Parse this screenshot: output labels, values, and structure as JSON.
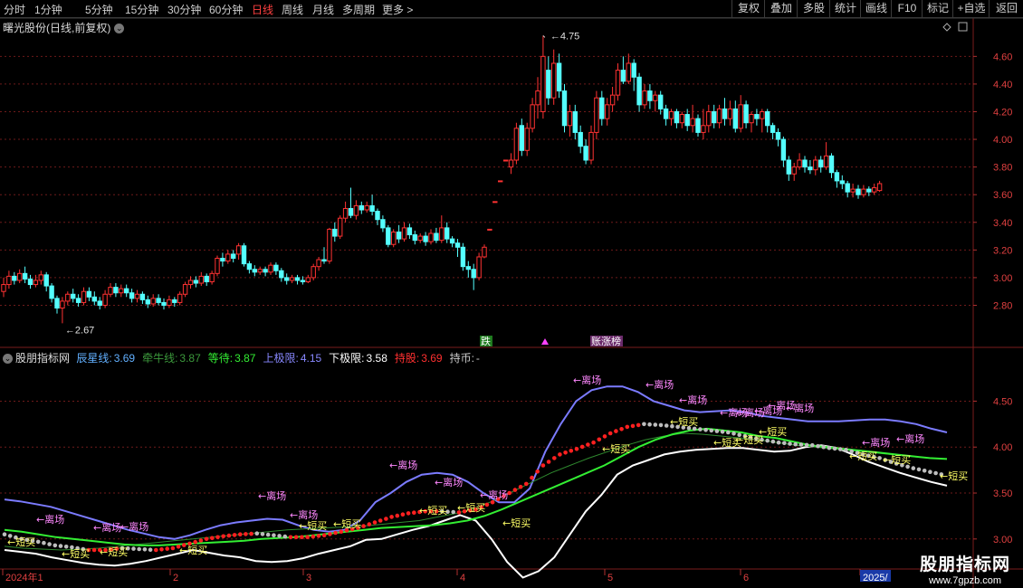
{
  "toolbar": {
    "periods": [
      "分时",
      "1分钟",
      "5分钟",
      "15分钟",
      "30分钟",
      "60分钟",
      "日线",
      "周线",
      "月线",
      "多周期",
      "更多 >"
    ],
    "active_period": "日线",
    "buttons": [
      "复权",
      "叠加",
      "多股",
      "统计",
      "画线",
      "F10",
      "标记",
      "+自选",
      "返回"
    ]
  },
  "main_chart": {
    "title": "曙光股份(日线,前复权)",
    "high_label": "4.75",
    "low_label": "2.67",
    "price_axis": [
      "4.60",
      "4.40",
      "4.20",
      "4.00",
      "3.80",
      "3.60",
      "3.40",
      "3.20",
      "3.00",
      "2.80"
    ],
    "markers": {
      "die": "跌",
      "zhangbang": "账涨榜"
    },
    "colors": {
      "up": "#ff3232",
      "down": "#54ffff",
      "bg": "#000000",
      "grid": "#6e1a1a"
    }
  },
  "indicator": {
    "name": "股朋指标网",
    "items": [
      {
        "label": "辰星线:",
        "value": "3.69",
        "color": "#62b0ff"
      },
      {
        "label": "牵牛线:",
        "value": "3.87",
        "color": "#3c9a3c"
      },
      {
        "label": "等待:",
        "value": "3.87",
        "color": "#33ee33"
      },
      {
        "label": "上极限:",
        "value": "4.15",
        "color": "#8888ff"
      },
      {
        "label": "下极限:",
        "value": "3.58",
        "color": "#ffffff"
      },
      {
        "label": "持股:",
        "value": "3.69",
        "color": "#ff3030"
      },
      {
        "label": "持币:",
        "value": "-",
        "color": "#cccccc"
      }
    ],
    "axis": [
      "4.50",
      "4.00",
      "3.50",
      "3.00"
    ],
    "signal_leave": "←离场",
    "signal_buy": "←短买"
  },
  "time_axis": [
    "2024年1",
    "2",
    "3",
    "4",
    "5",
    "6",
    "2025/"
  ],
  "watermark": {
    "title": "股朋指标网",
    "url": "www.7gpzb.com"
  },
  "chart_data": {
    "type": "candlestick",
    "title": "曙光股份(日线,前复权)",
    "ylim": [
      2.62,
      4.72
    ],
    "ylabels": [
      "4.60",
      "4.40",
      "4.20",
      "4.00",
      "3.80",
      "3.60",
      "3.40",
      "3.20",
      "3.00",
      "2.80"
    ],
    "annotations": {
      "max": 4.75,
      "min": 2.67
    },
    "candles": [
      [
        2.9,
        2.95,
        3.0,
        2.86
      ],
      [
        2.95,
        3.01,
        3.05,
        2.92
      ],
      [
        3.01,
        2.98,
        3.04,
        2.95
      ],
      [
        2.98,
        3.03,
        3.06,
        2.96
      ],
      [
        3.03,
        2.99,
        3.08,
        2.96
      ],
      [
        2.99,
        2.95,
        3.02,
        2.92
      ],
      [
        2.95,
        2.98,
        3.02,
        2.93
      ],
      [
        2.98,
        3.02,
        3.05,
        2.95
      ],
      [
        3.02,
        2.94,
        3.04,
        2.9
      ],
      [
        2.94,
        2.85,
        2.96,
        2.82
      ],
      [
        2.85,
        2.78,
        2.87,
        2.74
      ],
      [
        2.78,
        2.83,
        2.86,
        2.67
      ],
      [
        2.83,
        2.88,
        2.9,
        2.8
      ],
      [
        2.88,
        2.85,
        2.92,
        2.82
      ],
      [
        2.85,
        2.82,
        2.88,
        2.79
      ],
      [
        2.82,
        2.9,
        2.93,
        2.8
      ],
      [
        2.9,
        2.86,
        2.93,
        2.83
      ],
      [
        2.86,
        2.83,
        2.9,
        2.8
      ],
      [
        2.83,
        2.8,
        2.86,
        2.77
      ],
      [
        2.8,
        2.88,
        2.91,
        2.78
      ],
      [
        2.88,
        2.93,
        2.96,
        2.86
      ],
      [
        2.93,
        2.89,
        2.96,
        2.86
      ],
      [
        2.89,
        2.92,
        2.95,
        2.86
      ],
      [
        2.92,
        2.89,
        2.95,
        2.86
      ],
      [
        2.89,
        2.85,
        2.92,
        2.82
      ],
      [
        2.85,
        2.88,
        2.91,
        2.82
      ],
      [
        2.88,
        2.84,
        2.9,
        2.81
      ],
      [
        2.84,
        2.81,
        2.87,
        2.78
      ],
      [
        2.81,
        2.85,
        2.88,
        2.79
      ],
      [
        2.85,
        2.82,
        2.88,
        2.8
      ],
      [
        2.82,
        2.8,
        2.85,
        2.77
      ],
      [
        2.8,
        2.84,
        2.87,
        2.78
      ],
      [
        2.84,
        2.82,
        2.86,
        2.79
      ],
      [
        2.82,
        2.88,
        2.9,
        2.8
      ],
      [
        2.88,
        2.95,
        2.97,
        2.86
      ],
      [
        2.95,
        2.98,
        3.01,
        2.92
      ],
      [
        2.98,
        2.96,
        3.01,
        2.93
      ],
      [
        2.96,
        3.01,
        3.04,
        2.94
      ],
      [
        3.01,
        2.97,
        3.03,
        2.94
      ],
      [
        2.97,
        3.03,
        3.05,
        2.95
      ],
      [
        3.03,
        3.14,
        3.16,
        3.01
      ],
      [
        3.14,
        3.12,
        3.18,
        3.08
      ],
      [
        3.12,
        3.17,
        3.2,
        3.1
      ],
      [
        3.17,
        3.14,
        3.2,
        3.11
      ],
      [
        3.17,
        3.23,
        3.25,
        3.13
      ],
      [
        3.23,
        3.1,
        3.25,
        3.08
      ],
      [
        3.1,
        3.06,
        3.12,
        3.03
      ],
      [
        3.06,
        3.04,
        3.09,
        3.01
      ],
      [
        3.04,
        3.06,
        3.08,
        3.02
      ],
      [
        3.06,
        3.04,
        3.08,
        3.01
      ],
      [
        3.04,
        3.09,
        3.11,
        3.02
      ],
      [
        3.09,
        3.05,
        3.11,
        3.02
      ],
      [
        3.05,
        3.0,
        3.07,
        2.97
      ],
      [
        3.0,
        2.98,
        3.03,
        2.95
      ],
      [
        2.98,
        3.0,
        3.02,
        2.96
      ],
      [
        3.0,
        2.98,
        3.02,
        2.95
      ],
      [
        2.98,
        2.97,
        3.01,
        2.95
      ],
      [
        2.97,
        3.0,
        3.02,
        2.96
      ],
      [
        3.0,
        3.08,
        3.1,
        2.98
      ],
      [
        3.08,
        3.13,
        3.15,
        3.05
      ],
      [
        3.13,
        3.12,
        3.22,
        3.1
      ],
      [
        3.12,
        3.35,
        3.36,
        3.1
      ],
      [
        3.35,
        3.3,
        3.4,
        3.26
      ],
      [
        3.3,
        3.43,
        3.45,
        3.28
      ],
      [
        3.43,
        3.5,
        3.55,
        3.4
      ],
      [
        3.5,
        3.45,
        3.65,
        3.43
      ],
      [
        3.45,
        3.52,
        3.56,
        3.42
      ],
      [
        3.52,
        3.49,
        3.55,
        3.46
      ],
      [
        3.49,
        3.52,
        3.55,
        3.47
      ],
      [
        3.52,
        3.48,
        3.6,
        3.45
      ],
      [
        3.48,
        3.42,
        3.5,
        3.38
      ],
      [
        3.42,
        3.36,
        3.45,
        3.33
      ],
      [
        3.36,
        3.24,
        3.38,
        3.22
      ],
      [
        3.24,
        3.33,
        3.35,
        3.22
      ],
      [
        3.33,
        3.28,
        3.38,
        3.25
      ],
      [
        3.28,
        3.36,
        3.4,
        3.26
      ],
      [
        3.36,
        3.31,
        3.39,
        3.28
      ],
      [
        3.31,
        3.27,
        3.34,
        3.24
      ],
      [
        3.27,
        3.3,
        3.32,
        3.25
      ],
      [
        3.3,
        3.26,
        3.33,
        3.23
      ],
      [
        3.26,
        3.32,
        3.35,
        3.24
      ],
      [
        3.32,
        3.27,
        3.36,
        3.25
      ],
      [
        3.27,
        3.36,
        3.45,
        3.25
      ],
      [
        3.36,
        3.28,
        3.4,
        3.25
      ],
      [
        3.28,
        3.25,
        3.3,
        3.22
      ],
      [
        3.25,
        3.22,
        3.28,
        3.15
      ],
      [
        3.22,
        3.08,
        3.25,
        3.05
      ],
      [
        3.08,
        3.06,
        3.12,
        3.0
      ],
      [
        3.06,
        3.0,
        3.1,
        2.91
      ],
      [
        3.0,
        3.15,
        3.18,
        2.98
      ],
      [
        3.15,
        3.22,
        3.24,
        3.14
      ],
      [
        3.35,
        3.35,
        3.35,
        3.35
      ],
      [
        3.55,
        3.55,
        3.55,
        3.55
      ],
      [
        3.7,
        3.7,
        3.7,
        3.7
      ],
      [
        3.85,
        3.85,
        3.85,
        3.85
      ],
      [
        3.8,
        3.85,
        3.9,
        3.75
      ],
      [
        3.85,
        4.08,
        4.12,
        3.82
      ],
      [
        4.1,
        3.92,
        4.15,
        3.88
      ],
      [
        3.92,
        4.08,
        4.12,
        3.88
      ],
      [
        4.08,
        4.25,
        4.3,
        4.05
      ],
      [
        4.25,
        4.35,
        4.45,
        4.15
      ],
      [
        4.2,
        4.6,
        4.75,
        4.15
      ],
      [
        4.5,
        4.3,
        4.6,
        4.25
      ],
      [
        4.3,
        4.55,
        4.65,
        4.25
      ],
      [
        4.55,
        4.35,
        4.62,
        4.3
      ],
      [
        4.35,
        4.1,
        4.4,
        4.05
      ],
      [
        4.1,
        4.2,
        4.25,
        4.02
      ],
      [
        4.2,
        4.05,
        4.25,
        4.0
      ],
      [
        4.05,
        3.95,
        4.1,
        3.9
      ],
      [
        3.95,
        3.85,
        4.0,
        3.82
      ],
      [
        3.85,
        4.05,
        4.1,
        3.82
      ],
      [
        4.05,
        4.3,
        4.35,
        4.0
      ],
      [
        4.3,
        4.15,
        4.35,
        4.1
      ],
      [
        4.15,
        4.25,
        4.3,
        4.1
      ],
      [
        4.25,
        4.32,
        4.38,
        4.2
      ],
      [
        4.32,
        4.5,
        4.55,
        4.28
      ],
      [
        4.5,
        4.42,
        4.6,
        4.4
      ],
      [
        4.42,
        4.55,
        4.62,
        4.4
      ],
      [
        4.55,
        4.45,
        4.58,
        4.35
      ],
      [
        4.45,
        4.25,
        4.48,
        4.2
      ],
      [
        4.25,
        4.35,
        4.4,
        4.22
      ],
      [
        4.35,
        4.28,
        4.4,
        4.22
      ],
      [
        4.28,
        4.32,
        4.35,
        4.2
      ],
      [
        4.32,
        4.22,
        4.35,
        4.18
      ],
      [
        4.22,
        4.15,
        4.25,
        4.1
      ],
      [
        4.15,
        4.2,
        4.22,
        4.1
      ],
      [
        4.2,
        4.12,
        4.22,
        4.08
      ],
      [
        4.12,
        4.18,
        4.2,
        4.08
      ],
      [
        4.18,
        4.1,
        4.22,
        4.06
      ],
      [
        4.1,
        4.15,
        4.25,
        4.05
      ],
      [
        4.15,
        4.05,
        4.18,
        4.02
      ],
      [
        4.05,
        4.1,
        4.22,
        4.0
      ],
      [
        4.1,
        4.2,
        4.25,
        4.05
      ],
      [
        4.2,
        4.12,
        4.25,
        4.08
      ],
      [
        4.12,
        4.22,
        4.25,
        4.08
      ],
      [
        4.22,
        4.15,
        4.3,
        4.1
      ],
      [
        4.15,
        4.22,
        4.28,
        4.1
      ],
      [
        4.22,
        4.08,
        4.28,
        4.05
      ],
      [
        4.08,
        4.25,
        4.32,
        4.05
      ],
      [
        4.25,
        4.12,
        4.28,
        4.08
      ],
      [
        4.12,
        4.18,
        4.2,
        4.05
      ],
      [
        4.18,
        4.15,
        4.22,
        4.1
      ],
      [
        4.15,
        4.2,
        4.22,
        4.05
      ],
      [
        4.2,
        4.1,
        4.22,
        4.05
      ],
      [
        4.1,
        4.05,
        4.12,
        4.0
      ],
      [
        4.05,
        4.0,
        4.08,
        3.95
      ],
      [
        4.0,
        3.85,
        4.02,
        3.8
      ],
      [
        3.85,
        3.75,
        3.88,
        3.7
      ],
      [
        3.75,
        3.8,
        3.83,
        3.7
      ],
      [
        3.8,
        3.85,
        3.9,
        3.78
      ],
      [
        3.85,
        3.8,
        3.88,
        3.76
      ],
      [
        3.8,
        3.78,
        3.85,
        3.75
      ],
      [
        3.78,
        3.85,
        3.88,
        3.74
      ],
      [
        3.85,
        3.8,
        3.88,
        3.76
      ],
      [
        3.8,
        3.88,
        3.98,
        3.78
      ],
      [
        3.88,
        3.76,
        3.9,
        3.72
      ],
      [
        3.76,
        3.7,
        3.78,
        3.65
      ],
      [
        3.7,
        3.68,
        3.74,
        3.64
      ],
      [
        3.68,
        3.62,
        3.7,
        3.58
      ],
      [
        3.62,
        3.64,
        3.68,
        3.58
      ],
      [
        3.64,
        3.6,
        3.67,
        3.57
      ],
      [
        3.6,
        3.64,
        3.67,
        3.58
      ],
      [
        3.64,
        3.62,
        3.66,
        3.59
      ],
      [
        3.62,
        3.65,
        3.68,
        3.6
      ],
      [
        3.63,
        3.68,
        3.7,
        3.62
      ]
    ]
  },
  "indicator_data": {
    "ylim": [
      2.88,
      4.78
    ],
    "upper": [
      3.43,
      3.41,
      3.38,
      3.35,
      3.3,
      3.25,
      3.2,
      3.15,
      3.1,
      3.06,
      3.02,
      3.0,
      3.04,
      3.1,
      3.15,
      3.18,
      3.2,
      3.22,
      3.21,
      3.15,
      3.1,
      3.08,
      3.1,
      3.2,
      3.4,
      3.5,
      3.62,
      3.7,
      3.72,
      3.7,
      3.62,
      3.5,
      3.4,
      3.4,
      3.55,
      3.95,
      4.25,
      4.5,
      4.62,
      4.66,
      4.66,
      4.6,
      4.5,
      4.45,
      4.4,
      4.38,
      4.39,
      4.4,
      4.38,
      4.34,
      4.32,
      4.3,
      4.28,
      4.28,
      4.28,
      4.29,
      4.3,
      4.3,
      4.28,
      4.25,
      4.2,
      4.16
    ],
    "lower": [
      2.88,
      2.86,
      2.84,
      2.8,
      2.77,
      2.74,
      2.72,
      2.71,
      2.73,
      2.76,
      2.8,
      2.84,
      2.88,
      2.85,
      2.82,
      2.8,
      2.76,
      2.75,
      2.76,
      2.79,
      2.84,
      2.88,
      2.92,
      2.99,
      3.0,
      3.05,
      3.1,
      3.14,
      3.2,
      3.26,
      3.2,
      3.0,
      2.75,
      2.58,
      2.65,
      2.8,
      3.05,
      3.3,
      3.48,
      3.7,
      3.8,
      3.86,
      3.92,
      3.95,
      3.97,
      3.98,
      3.99,
      3.99,
      3.97,
      3.95,
      3.96,
      4.0,
      4.02,
      3.99,
      3.92,
      3.84,
      3.78,
      3.72,
      3.67,
      3.62,
      3.58
    ],
    "holding_line": [
      3.05,
      3.0,
      2.97,
      2.93,
      2.91,
      2.88,
      2.88,
      2.9,
      2.89,
      2.88,
      2.9,
      2.95,
      3.0,
      3.03,
      3.05,
      3.06,
      3.04,
      3.02,
      3.02,
      3.04,
      3.08,
      3.12,
      3.18,
      3.24,
      3.28,
      3.3,
      3.3,
      3.29,
      3.32,
      3.4,
      3.5,
      3.6,
      3.8,
      3.92,
      3.98,
      4.05,
      4.15,
      4.22,
      4.25,
      4.24,
      4.22,
      4.2,
      4.18,
      4.16,
      4.12,
      4.08,
      4.05,
      4.03,
      4.02,
      3.99,
      3.97,
      3.92,
      3.88,
      3.82,
      3.77,
      3.73,
      3.69
    ],
    "wait_line": [
      3.1,
      3.08,
      3.05,
      3.02,
      3.0,
      2.98,
      2.96,
      2.94,
      2.93,
      2.93,
      2.94,
      2.95,
      2.96,
      2.97,
      2.98,
      3.0,
      3.01,
      3.02,
      3.04,
      3.06,
      3.08,
      3.1,
      3.12,
      3.13,
      3.14,
      3.15,
      3.17,
      3.2,
      3.25,
      3.32,
      3.4,
      3.48,
      3.56,
      3.64,
      3.72,
      3.8,
      3.9,
      4.0,
      4.08,
      4.14,
      4.18,
      4.2,
      4.18,
      4.16,
      4.12,
      4.1,
      4.06,
      4.02,
      4.0,
      3.98,
      3.96,
      3.94,
      3.92,
      3.9,
      3.88,
      3.87
    ],
    "pull_line": [
      2.92,
      2.9,
      2.89,
      2.88,
      2.89,
      2.9,
      2.92,
      2.94,
      2.96,
      2.98,
      3.0,
      3.02,
      3.04,
      3.06,
      3.08,
      3.1,
      3.11,
      3.12,
      3.13,
      3.14,
      3.16,
      3.18,
      3.2,
      3.24,
      3.28,
      3.34,
      3.42,
      3.52,
      3.62,
      3.72,
      3.8,
      3.88,
      3.95,
      4.02,
      4.08,
      4.12,
      4.15,
      4.14,
      4.12,
      4.1,
      4.08,
      4.05,
      4.02,
      4.0,
      3.98,
      3.96,
      3.94,
      3.92,
      3.9,
      3.88,
      3.87
    ]
  }
}
